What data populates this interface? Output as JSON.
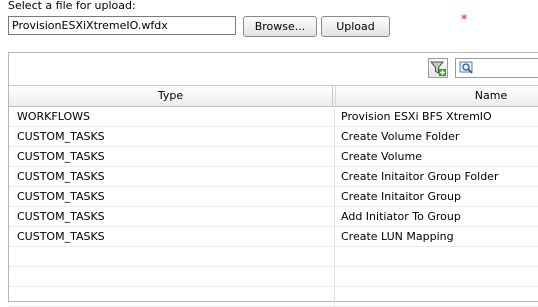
{
  "upload": {
    "label": "Select a file for upload:",
    "file_value": "ProvisionESXiXtremeIO.wfdx",
    "browse_label": "Browse...",
    "upload_label": "Upload",
    "required_mark": "*"
  },
  "toolbar": {
    "filter_icon": "filter-add-icon",
    "search_icon": "search-icon"
  },
  "table": {
    "columns": [
      "Type",
      "Name"
    ],
    "rows": [
      {
        "type": "WORKFLOWS",
        "name": "Provision ESXi BFS XtremIO"
      },
      {
        "type": "CUSTOM_TASKS",
        "name": "Create Volume Folder"
      },
      {
        "type": "CUSTOM_TASKS",
        "name": "Create Volume"
      },
      {
        "type": "CUSTOM_TASKS",
        "name": "Create Initaitor Group Folder"
      },
      {
        "type": "CUSTOM_TASKS",
        "name": "Create Initaitor Group"
      },
      {
        "type": "CUSTOM_TASKS",
        "name": "Add Initiator To Group"
      },
      {
        "type": "CUSTOM_TASKS",
        "name": "Create LUN Mapping"
      },
      {
        "type": "",
        "name": ""
      },
      {
        "type": "",
        "name": ""
      },
      {
        "type": "",
        "name": ""
      }
    ]
  }
}
